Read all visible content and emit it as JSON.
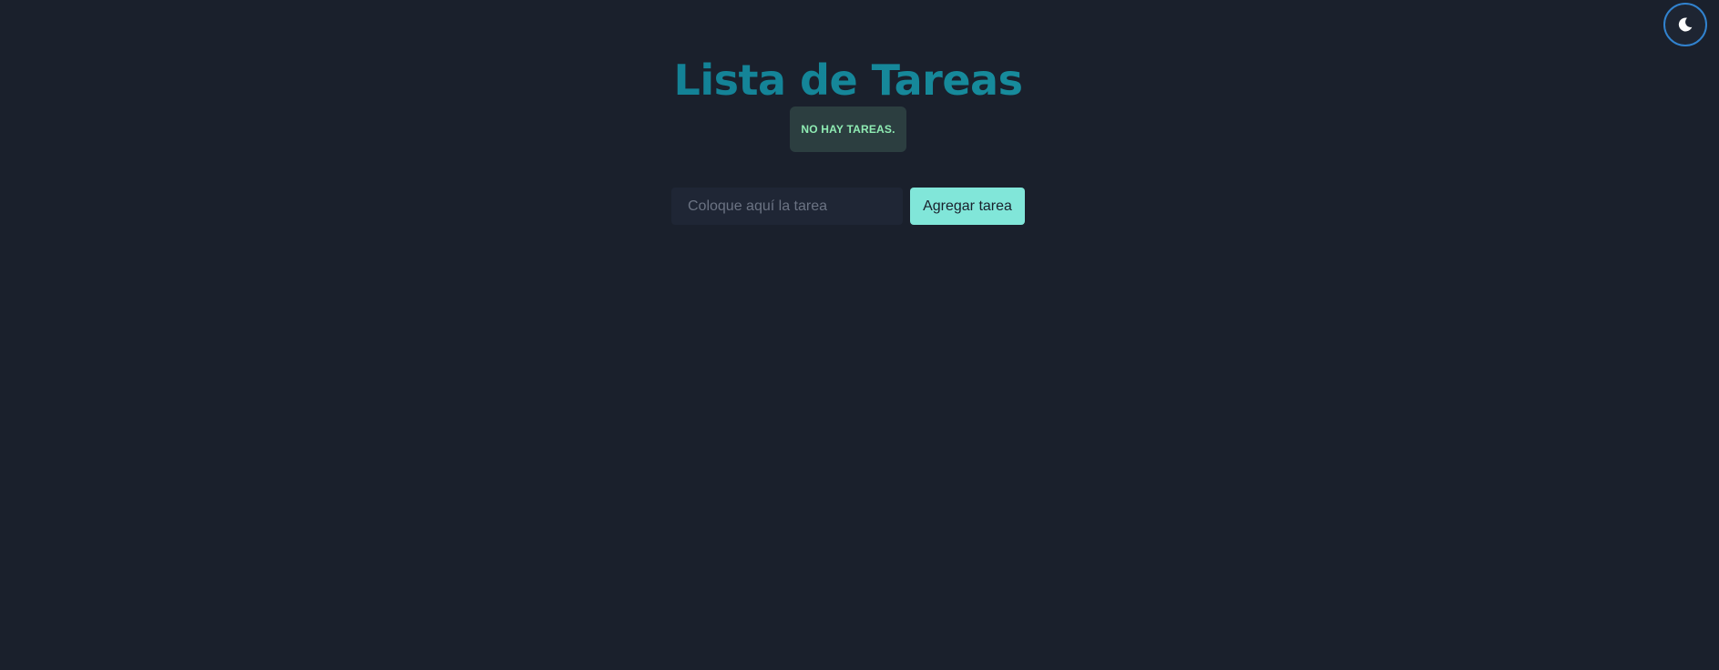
{
  "theme_toggle": {
    "icon": "moon-icon"
  },
  "header": {
    "title": "Lista de Tareas"
  },
  "status": {
    "empty_message": "No hay tareas."
  },
  "form": {
    "input_value": "",
    "input_placeholder": "Coloque aquí la tarea",
    "add_label": "Agregar tarea"
  },
  "colors": {
    "background": "#1a202c",
    "accent": "#81e6d9",
    "toggle_border": "#3182ce",
    "badge_text": "#8fecb3",
    "title_gradient_start": "#0b6f8c",
    "title_gradient_end": "#1f9ea6"
  },
  "tasks": []
}
